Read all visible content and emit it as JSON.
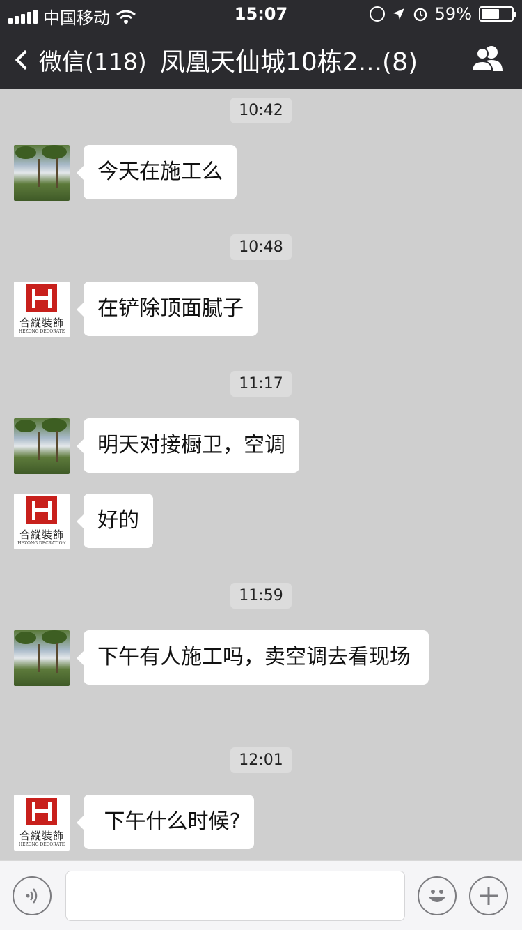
{
  "status_bar": {
    "carrier": "中国移动",
    "time": "15:07",
    "battery_text": "59%",
    "battery_level": 0.59
  },
  "nav": {
    "back_label": "微信(118)",
    "title": "凤凰天仙城10栋2...(8)"
  },
  "messages": [
    {
      "timestamp": "10:42",
      "avatar": "tree-avatar",
      "text": "今天在施工么"
    },
    {
      "timestamp": "10:48",
      "avatar": "hezong-logo-avatar",
      "text": "在铲除顶面腻子"
    },
    {
      "timestamp": "11:17",
      "avatar": "tree-avatar",
      "text": "明天对接橱卫，空调"
    },
    {
      "timestamp": "",
      "avatar": "hezong-logo-avatar",
      "text": "好的"
    },
    {
      "timestamp": "11:59",
      "avatar": "tree-avatar",
      "text": "下午有人施工吗，卖空调去看现场"
    },
    {
      "timestamp": "12:01",
      "avatar": "hezong-logo-avatar",
      "text": " 下午什么时候?"
    }
  ],
  "logo_avatar": {
    "cn_text": "合縱裝飾",
    "en_text": "HEZONG DECORATE",
    "en_text_alt": "HEZONG DECRATION"
  },
  "input_bar": {
    "voice_icon": "voice-icon",
    "emoji_icon": "emoji-icon",
    "plus_icon": "plus-icon"
  },
  "colors": {
    "topbar": "#2b2b2f",
    "chat_background": "#cfcfcf",
    "bubble": "#ffffff",
    "logo_red": "#c8201c"
  }
}
